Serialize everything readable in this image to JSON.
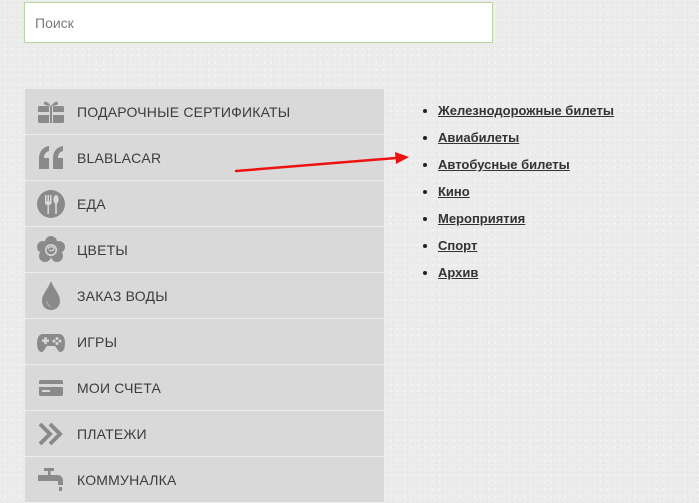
{
  "search": {
    "placeholder": "Поиск"
  },
  "menu": {
    "items": [
      {
        "label": "ПОДАРОЧНЫЕ СЕРТИФИКАТЫ",
        "icon": "gift-certificate-icon"
      },
      {
        "label": "BLABLACAR",
        "icon": "blablacar-quote-icon"
      },
      {
        "label": "ЕДА",
        "icon": "food-utensils-icon"
      },
      {
        "label": "ЦВЕТЫ",
        "icon": "flower-rose-icon"
      },
      {
        "label": "ЗАКАЗ ВОДЫ",
        "icon": "water-drop-icon"
      },
      {
        "label": "ИГРЫ",
        "icon": "gamepad-icon"
      },
      {
        "label": "МОИ СЧЕТА",
        "icon": "credit-card-icon"
      },
      {
        "label": "ПЛАТЕЖИ",
        "icon": "double-chevron-right-icon"
      },
      {
        "label": "КОММУНАЛКА",
        "icon": "faucet-icon"
      }
    ]
  },
  "links": [
    "Железнодорожные билеты",
    "Авиабилеты",
    "Автобусные билеты",
    "Кино",
    "Мероприятия",
    "Спорт",
    "Архив"
  ],
  "colors": {
    "menu_background": "#d9d9d9",
    "icon_gray": "#8a8a8a",
    "annotation_arrow": "#ee1111",
    "search_border": "#b5d6a0"
  }
}
